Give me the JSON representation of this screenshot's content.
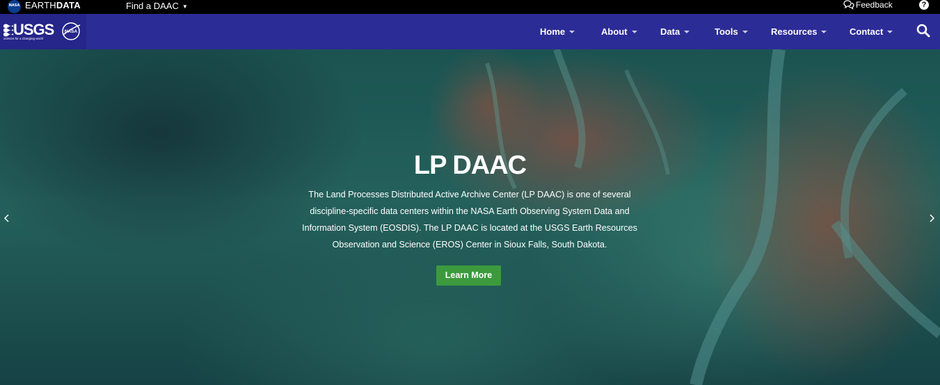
{
  "topbar": {
    "nasa_mark": "NASA",
    "site_name_light": "EARTH",
    "site_name_bold": "DATA",
    "find_daac": "Find a DAAC",
    "feedback": "Feedback",
    "help": "?"
  },
  "navbar": {
    "usgs_word": "USGS",
    "usgs_tagline": "science for a changing world",
    "nasa_text": "NASA",
    "items": [
      {
        "label": "Home"
      },
      {
        "label": "About"
      },
      {
        "label": "Data"
      },
      {
        "label": "Tools"
      },
      {
        "label": "Resources"
      },
      {
        "label": "Contact"
      }
    ],
    "search_icon": "search-icon"
  },
  "hero": {
    "title": "LP DAAC",
    "description": "The Land Processes Distributed Active Archive Center (LP DAAC) is one of several discipline-specific data centers within the NASA Earth Observing System Data and Information System (EOSDIS). The LP DAAC is located at the USGS Earth Resources Observation and Science (EROS) Center in Sioux Falls, South Dakota.",
    "button": "Learn More",
    "button_color": "#3c9a3c"
  },
  "colors": {
    "topbar": "#000000",
    "navbar": "#2c2c97"
  }
}
